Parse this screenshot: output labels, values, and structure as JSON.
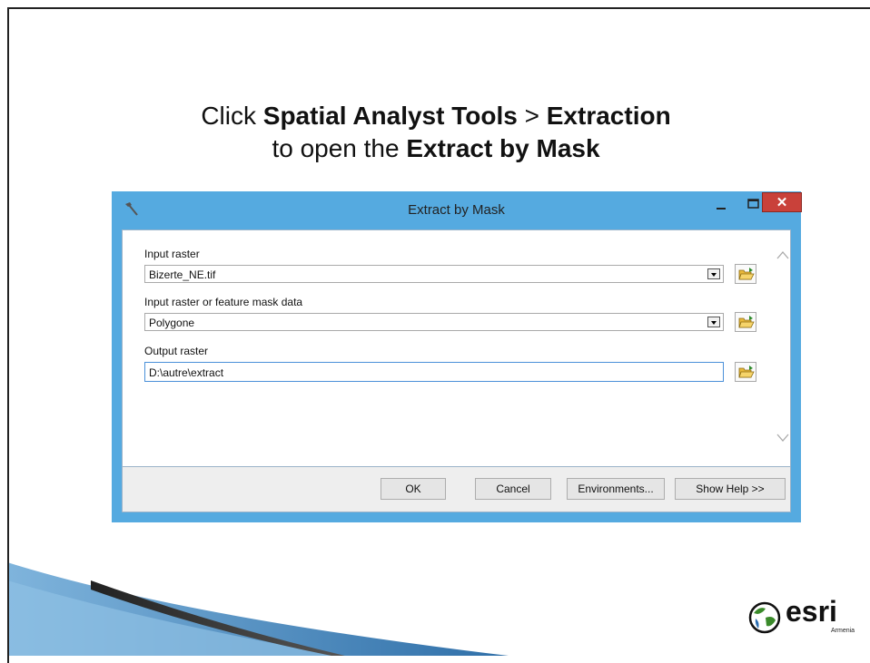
{
  "slide": {
    "line1_pre": "Click ",
    "line1_bold1": "Spatial Analyst Tools",
    "line1_mid": " > ",
    "line1_bold2": "Extraction",
    "line2_pre": "to open the ",
    "line2_bold": "Extract by Mask"
  },
  "dialog": {
    "title": "Extract by Mask",
    "close_glyph": "✕",
    "fields": [
      {
        "label": "Input raster",
        "value": "Bizerte_NE.tif"
      },
      {
        "label": "Input raster or feature mask data",
        "value": "Polygone"
      },
      {
        "label": "Output raster",
        "value": "D:\\autre\\extract"
      }
    ],
    "buttons": {
      "ok": "OK",
      "cancel": "Cancel",
      "environments": "Environments...",
      "help": "Show Help >>"
    }
  },
  "logo": {
    "word": "esri",
    "sub": "Armenia"
  },
  "colors": {
    "dialog_frame": "#55aae0",
    "close_button": "#c9413a",
    "deco_blue": "#4d8fc6"
  }
}
